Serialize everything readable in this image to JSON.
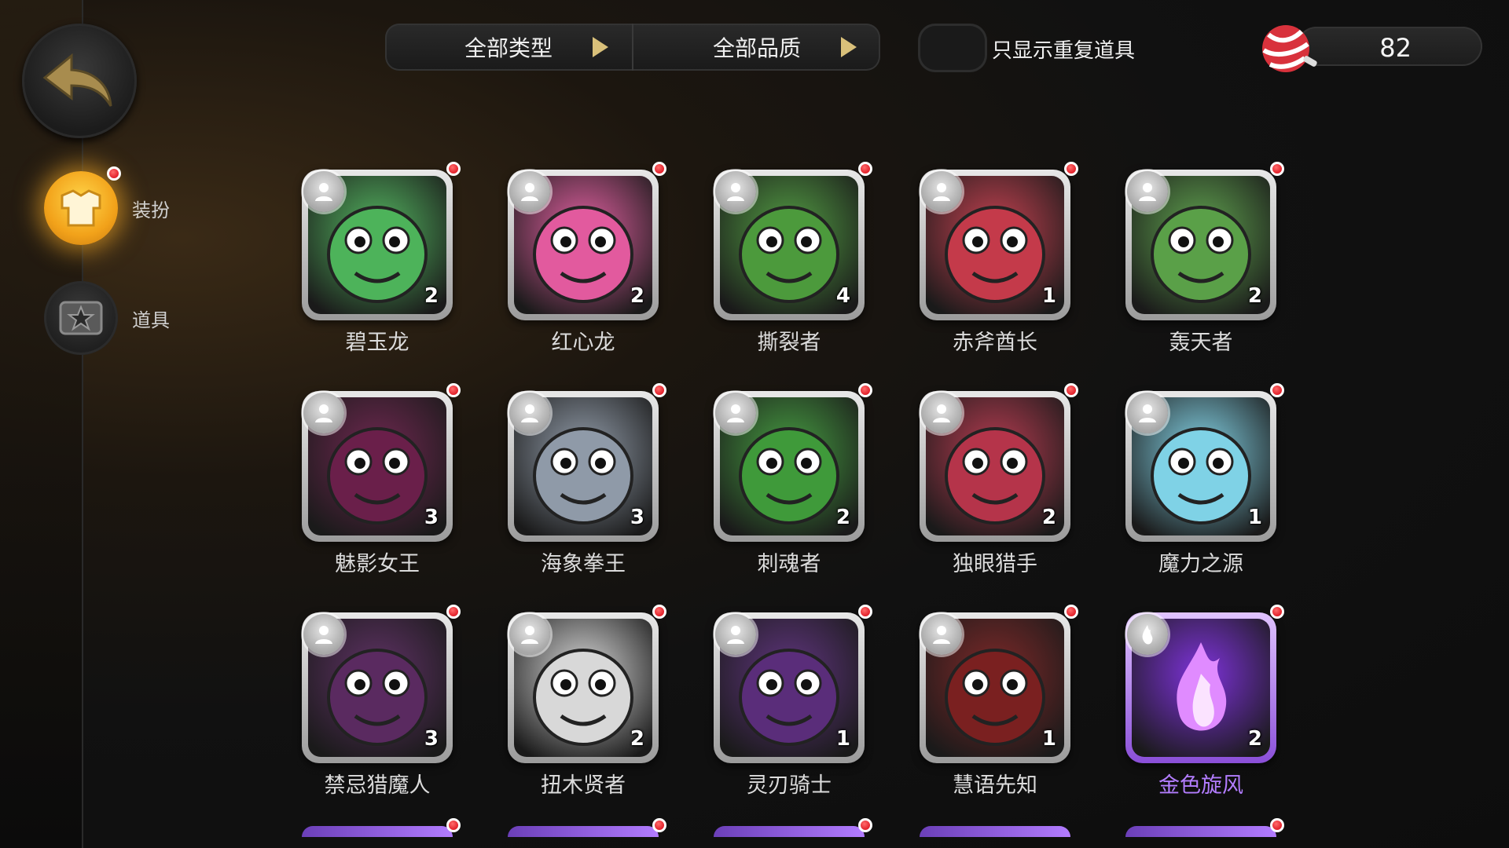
{
  "filters": {
    "type_label": "全部类型",
    "quality_label": "全部品质"
  },
  "toggle": {
    "label": "只显示重复道具",
    "on": false
  },
  "currency": {
    "value": "82",
    "icon": "candy-icon"
  },
  "sidebar": {
    "items": [
      {
        "label": "装扮",
        "icon": "outfit-icon",
        "active": true,
        "has_dot": true
      },
      {
        "label": "道具",
        "icon": "props-icon",
        "active": false,
        "has_dot": false
      }
    ]
  },
  "colors": {
    "accent": "#f2a21a",
    "epic": "#b37dff",
    "notify": "#e2212b"
  },
  "items": [
    {
      "name": "碧玉龙",
      "count": "2",
      "art": "#4db35a",
      "rarity": "common"
    },
    {
      "name": "红心龙",
      "count": "2",
      "art": "#e25a9e",
      "rarity": "common"
    },
    {
      "name": "撕裂者",
      "count": "4",
      "art": "#4c9a3c",
      "rarity": "common"
    },
    {
      "name": "赤斧酋长",
      "count": "1",
      "art": "#c43a4a",
      "rarity": "common"
    },
    {
      "name": "轰天者",
      "count": "2",
      "art": "#5aa048",
      "rarity": "common"
    },
    {
      "name": "魅影女王",
      "count": "3",
      "art": "#6a1f4a",
      "rarity": "common"
    },
    {
      "name": "海象拳王",
      "count": "3",
      "art": "#8f9aa8",
      "rarity": "common"
    },
    {
      "name": "刺魂者",
      "count": "2",
      "art": "#3f9a3a",
      "rarity": "common"
    },
    {
      "name": "独眼猎手",
      "count": "2",
      "art": "#b5344a",
      "rarity": "common"
    },
    {
      "name": "魔力之源",
      "count": "1",
      "art": "#7fd2e6",
      "rarity": "common"
    },
    {
      "name": "禁忌猎魔人",
      "count": "3",
      "art": "#5a2a60",
      "rarity": "common"
    },
    {
      "name": "扭木贤者",
      "count": "2",
      "art": "#d8d8d8",
      "rarity": "common"
    },
    {
      "name": "灵刃骑士",
      "count": "1",
      "art": "#5a2d7a",
      "rarity": "common"
    },
    {
      "name": "慧语先知",
      "count": "1",
      "art": "#7a2020",
      "rarity": "common"
    },
    {
      "name": "金色旋风",
      "count": "2",
      "art": "#7a2dd8",
      "rarity": "epic"
    }
  ]
}
